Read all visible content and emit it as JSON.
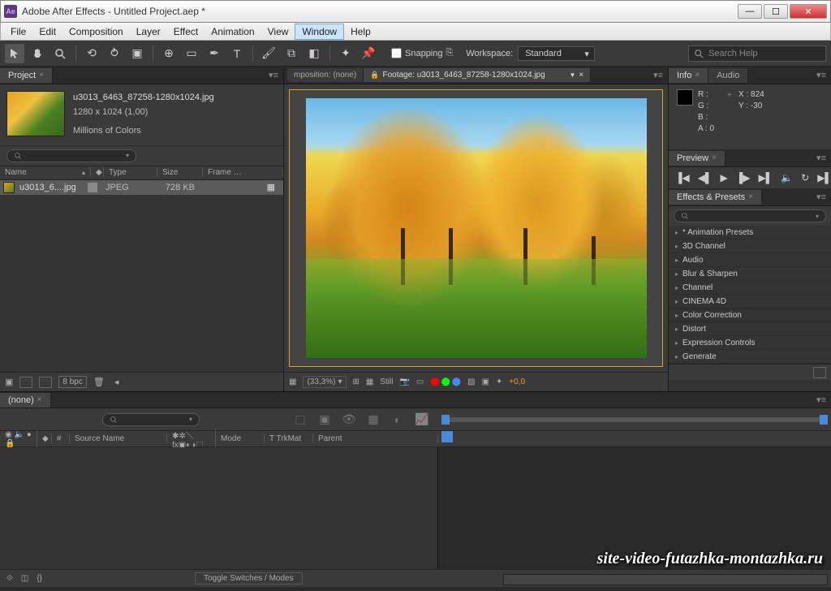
{
  "window": {
    "title": "Adobe After Effects - Untitled Project.aep *",
    "app_abbrev": "Ae"
  },
  "menubar": [
    "File",
    "Edit",
    "Composition",
    "Layer",
    "Effect",
    "Animation",
    "View",
    "Window",
    "Help"
  ],
  "menubar_open_index": 7,
  "toolbar": {
    "snapping_label": "Snapping",
    "workspace_label": "Workspace:",
    "workspace_value": "Standard",
    "search_placeholder": "Search Help"
  },
  "project": {
    "tab": "Project",
    "selected": {
      "name": "u3013_6463_87258-1280x1024.jpg",
      "dims": "1280 x 1024 (1,00)",
      "colors": "Millions of Colors"
    },
    "columns": {
      "name": "Name",
      "type": "Type",
      "size": "Size",
      "frame": "Frame …"
    },
    "row": {
      "name": "u3013_6....jpg",
      "type": "JPEG",
      "size": "728 KB"
    },
    "footer_bpc": "8 bpc"
  },
  "viewer": {
    "tab1": "mposition: (none)",
    "tab2": "Footage: u3013_6463_87258-1280x1024.jpg",
    "zoom": "(33,3%)",
    "res": "Still",
    "exposure": "+0,0"
  },
  "info": {
    "tab1": "Info",
    "tab2": "Audio",
    "R": "R :",
    "G": "G :",
    "B": "B :",
    "A": "A : 0",
    "X": "X : 824",
    "Y": "Y : -30"
  },
  "preview": {
    "tab": "Preview"
  },
  "effects": {
    "tab": "Effects & Presets",
    "items": [
      "* Animation Presets",
      "3D Channel",
      "Audio",
      "Blur & Sharpen",
      "Channel",
      "CINEMA 4D",
      "Color Correction",
      "Distort",
      "Expression Controls",
      "Generate"
    ]
  },
  "timeline": {
    "tab": "(none)",
    "cols": {
      "num": "#",
      "source": "Source Name",
      "mode": "Mode",
      "trk": "T  TrkMat",
      "parent": "Parent"
    },
    "toggle": "Toggle Switches / Modes"
  },
  "watermark": "site-video-futazhka-montazhka.ru"
}
